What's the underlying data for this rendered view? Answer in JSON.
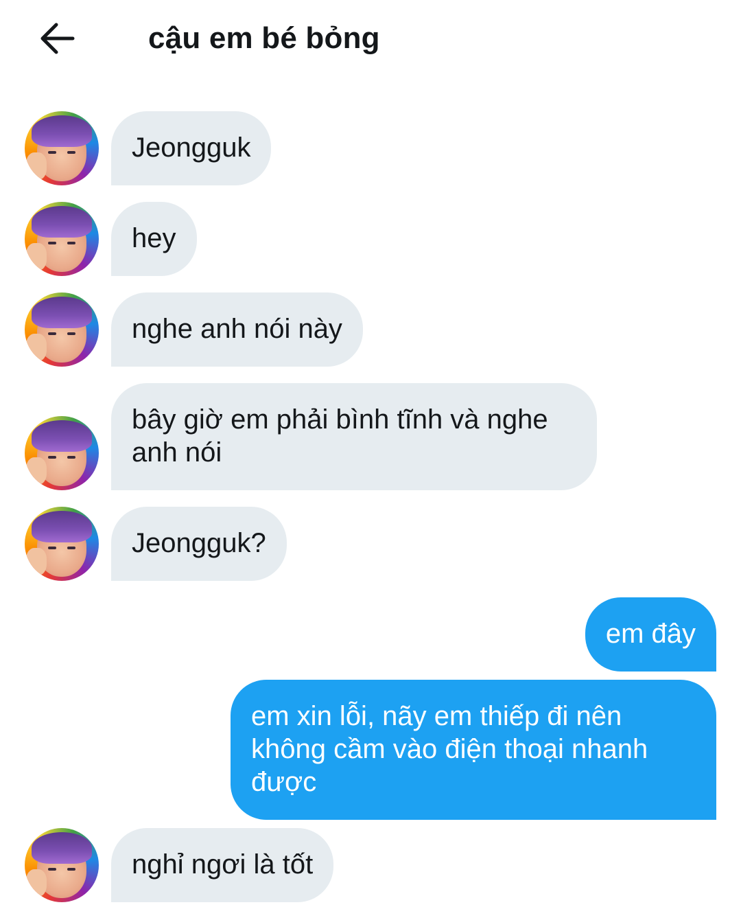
{
  "header": {
    "title": "cậu em bé bỏng",
    "back_icon": "arrow-left-icon"
  },
  "colors": {
    "incoming_bubble": "#e6ecf0",
    "outgoing_bubble": "#1da1f2",
    "outgoing_text": "#ffffff",
    "incoming_text": "#14171a"
  },
  "messages": [
    {
      "sender": "them",
      "text": "Jeongguk"
    },
    {
      "sender": "them",
      "text": "hey"
    },
    {
      "sender": "them",
      "text": "nghe anh nói này"
    },
    {
      "sender": "them",
      "text": "bây giờ em phải bình tĩnh và nghe anh nói"
    },
    {
      "sender": "them",
      "text": "Jeongguk?"
    },
    {
      "sender": "me",
      "text": "em đây"
    },
    {
      "sender": "me",
      "text": "em xin lỗi, nãy em thiếp đi nên không cầm vào điện thoại nhanh được"
    },
    {
      "sender": "them",
      "text": "nghỉ ngơi là tốt"
    }
  ]
}
